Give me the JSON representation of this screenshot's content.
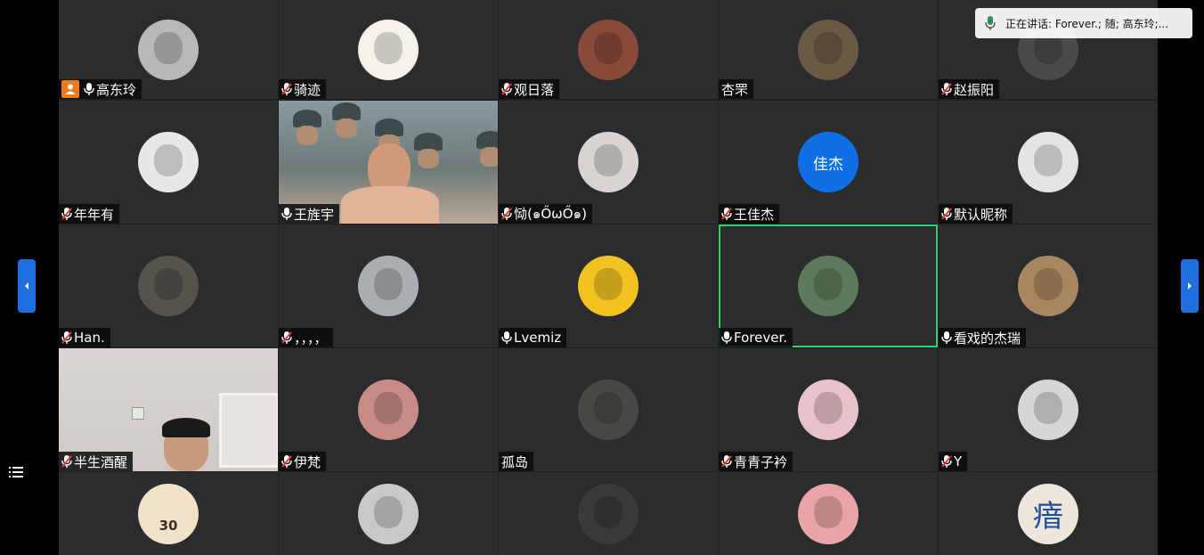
{
  "speaking_indicator": {
    "text": "正在讲话: Forever.; 随; 高东玲;..."
  },
  "participants": [
    {
      "name": "高东玲",
      "mic": "on",
      "host": true,
      "avatar_color": "#b8b8b8",
      "avatar_icon": "photo-avatar"
    },
    {
      "name": "骑迹",
      "mic": "muted",
      "avatar_color": "#f5f1ea",
      "avatar_icon": "cartoon-boy-avatar"
    },
    {
      "name": "观日落",
      "mic": "muted",
      "avatar_color": "#8a4a3a",
      "avatar_icon": "robot-avatar"
    },
    {
      "name": "杏罘",
      "mic": "none",
      "avatar_color": "#6b5a43",
      "avatar_icon": "photo-avatar"
    },
    {
      "name": "赵振阳",
      "mic": "muted",
      "avatar_color": "#4a4a48",
      "avatar_icon": "photo-avatar"
    },
    {
      "name": "年年有",
      "mic": "muted",
      "avatar_color": "#e9e6ea",
      "avatar_icon": "anime-girl-avatar"
    },
    {
      "name": "王旌宇",
      "mic": "on",
      "video": true
    },
    {
      "name": "恸(๑ŐωŐ๑)",
      "mic": "muted",
      "avatar_color": "#d9d4cf",
      "avatar_icon": "anime-boy-avatar"
    },
    {
      "name": "王佳杰",
      "mic": "muted",
      "avatar_color": "#0f6fe6",
      "avatar_text": "佳杰"
    },
    {
      "name": "默认昵称",
      "mic": "muted",
      "avatar_color": "#e4e4e6",
      "avatar_icon": "anime-girl-avatar"
    },
    {
      "name": "Han.",
      "mic": "muted",
      "avatar_color": "#56524c",
      "avatar_icon": "photo-avatar"
    },
    {
      "name": "，，，，",
      "mic": "muted",
      "avatar_color": "#a9aeb0",
      "avatar_icon": "anime-avatar"
    },
    {
      "name": "Lvemiz",
      "mic": "on",
      "avatar_color": "#f2c320",
      "avatar_icon": "anime-boy-avatar"
    },
    {
      "name": "Forever.",
      "mic": "on",
      "active": true,
      "avatar_color": "#5d7b5a",
      "avatar_icon": "landscape-avatar"
    },
    {
      "name": "看戏的杰瑞",
      "mic": "on",
      "avatar_color": "#a8865e",
      "avatar_icon": "photo-avatar"
    },
    {
      "name": "半生酒醒",
      "mic": "muted",
      "video": true,
      "video_style": "room"
    },
    {
      "name": "伊梵",
      "mic": "muted",
      "avatar_color": "#c98b85",
      "avatar_icon": "photo-avatar"
    },
    {
      "name": "孤岛",
      "mic": "none",
      "avatar_color": "#4a4844",
      "avatar_icon": "silhouette-avatar"
    },
    {
      "name": "青青子衿",
      "mic": "muted",
      "avatar_color": "#e8c2c9",
      "avatar_icon": "photo-avatar"
    },
    {
      "name": "Y",
      "mic": "muted",
      "avatar_color": "#d6d6d6",
      "avatar_icon": "hooded-avatar"
    },
    {
      "name": "",
      "mic": "none",
      "avatar_color": "#f0e2c8",
      "avatar_icon": "jersey-avatar",
      "avatar_text": "30"
    },
    {
      "name": "",
      "mic": "none",
      "avatar_color": "#c9c9c9",
      "avatar_icon": "silhouette-avatar"
    },
    {
      "name": "",
      "mic": "none",
      "avatar_color": "#3a3a3a",
      "avatar_icon": "photo-avatar"
    },
    {
      "name": "",
      "mic": "none",
      "avatar_color": "#e9a4a6",
      "avatar_icon": "cartoon-face-avatar"
    },
    {
      "name": "",
      "mic": "none",
      "avatar_color": "#ede6da",
      "avatar_icon": "text-avatar",
      "avatar_text": "瘖"
    }
  ],
  "colors": {
    "active_border": "#2bd46b",
    "nav_arrow": "#1f6fe0",
    "host_badge": "#f07a1a",
    "muted_red": "#e23b3b"
  },
  "icons": {
    "left_nav": "chevron-left-icon",
    "right_nav": "chevron-right-icon",
    "menu": "list-menu-icon",
    "mic": "microphone-icon",
    "mic_muted": "microphone-muted-icon",
    "host": "host-person-icon"
  }
}
